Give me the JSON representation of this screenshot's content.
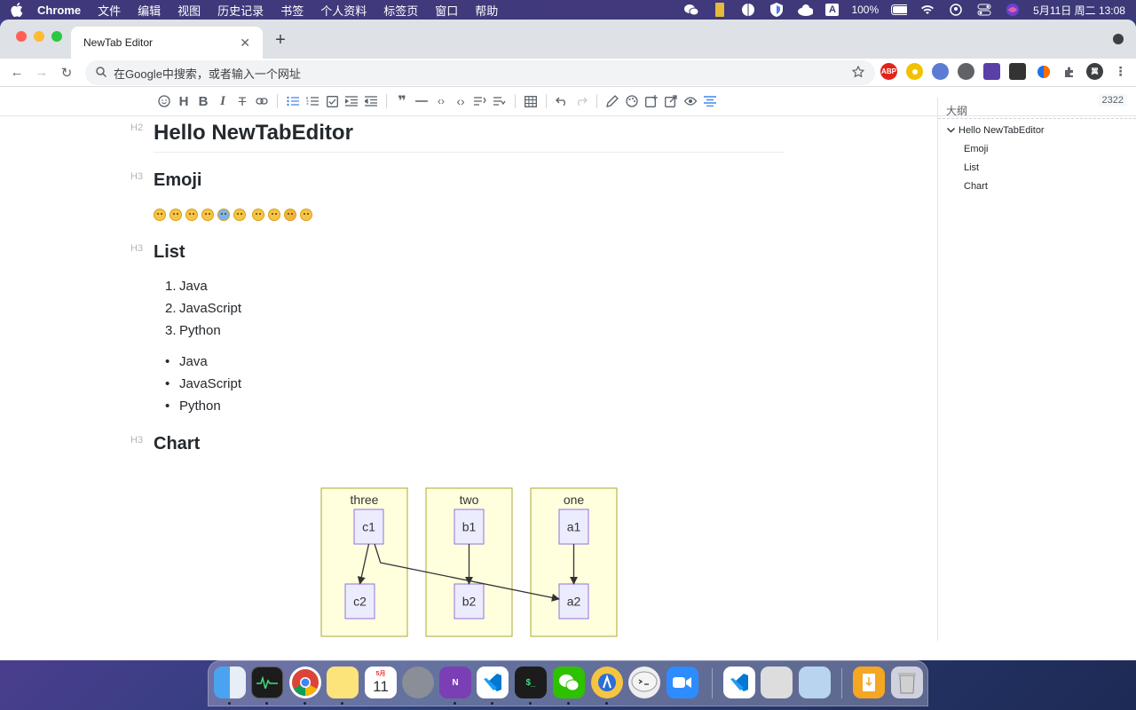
{
  "menubar": {
    "app": "Chrome",
    "items": [
      "文件",
      "编辑",
      "视图",
      "历史记录",
      "书签",
      "个人资料",
      "标签页",
      "窗口",
      "帮助"
    ],
    "battery": "100%",
    "datetime": "5月11日 周二  13:08",
    "input_method": "A"
  },
  "browser": {
    "tab_title": "NewTab Editor",
    "omnibox_placeholder": "在Google中搜索，或者输入一个网址",
    "ext_abp": "ABP",
    "profile_initial": "翼"
  },
  "editor": {
    "counter": "2322",
    "heading1": {
      "level": "H2",
      "text": "Hello NewTabEditor"
    },
    "heading2": {
      "level": "H3",
      "text": "Emoji"
    },
    "heading3": {
      "level": "H3",
      "text": "List"
    },
    "heading4": {
      "level": "H3",
      "text": "Chart"
    },
    "ordered_list": [
      "Java",
      "JavaScript",
      "Python"
    ],
    "ordered_markers": [
      "1.",
      "2.",
      "3."
    ],
    "bullet_list": [
      "Java",
      "JavaScript",
      "Python"
    ],
    "emoji_count": 10
  },
  "outline": {
    "title": "大纲",
    "root": "Hello NewTabEditor",
    "children": [
      "Emoji",
      "List",
      "Chart"
    ]
  },
  "chart_data": {
    "type": "flowchart",
    "subgraphs": [
      {
        "label": "three",
        "nodes": [
          "c1",
          "c2"
        ]
      },
      {
        "label": "two",
        "nodes": [
          "b1",
          "b2"
        ]
      },
      {
        "label": "one",
        "nodes": [
          "a1",
          "a2"
        ]
      }
    ],
    "edges": [
      [
        "c1",
        "c2"
      ],
      [
        "b1",
        "b2"
      ],
      [
        "a1",
        "a2"
      ],
      [
        "c1",
        "a2"
      ]
    ]
  },
  "dock": {
    "calendar_month": "5月",
    "calendar_day": "11"
  },
  "colors": {
    "accent": "#4285f4",
    "subgraph_fill": "#ffffde",
    "subgraph_stroke": "#aaaa33",
    "node_fill": "#ececff",
    "node_stroke": "#9370db"
  }
}
